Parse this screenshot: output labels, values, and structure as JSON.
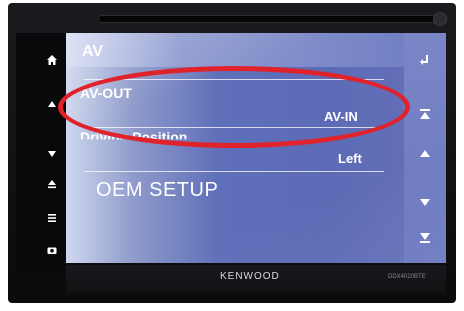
{
  "screen": {
    "title": "AV",
    "items": [
      {
        "label": "AV-OUT",
        "value": "AV-IN"
      },
      {
        "label": "Driving Position",
        "value": "Left"
      }
    ],
    "oem_setup": "OEM SETUP"
  },
  "device": {
    "brand": "KENWOOD",
    "model": "DDX4020BTE"
  },
  "annotation": {
    "ellipse_color": "#e0232b"
  },
  "icons": {
    "left_panel": [
      "home-icon",
      "arrow-up-icon",
      "arrow-down-icon",
      "eject-icon",
      "menu-icon",
      "camera-icon"
    ],
    "right_panel": [
      "back-icon",
      "scroll-top-icon",
      "scroll-up-icon",
      "scroll-down-icon",
      "scroll-bottom-icon"
    ]
  }
}
